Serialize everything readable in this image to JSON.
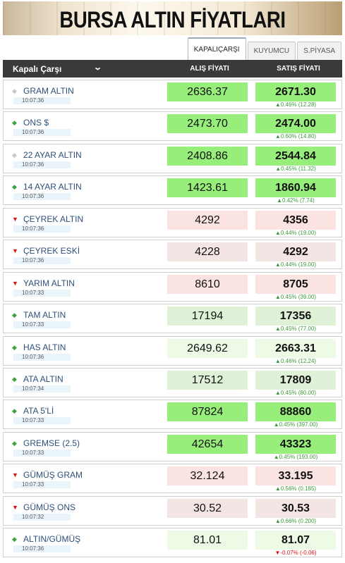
{
  "banner": {
    "title": "BURSA ALTIN FİYATLARI"
  },
  "tabs": [
    {
      "label": "KAPALIÇARŞI",
      "active": true
    },
    {
      "label": "KUYUMCU",
      "active": false
    },
    {
      "label": "S.PİYASA",
      "active": false
    }
  ],
  "header": {
    "market": "Kapalı Çarşı",
    "buy_label": "ALIŞ FİYATI",
    "sell_label": "SATIŞ FİYATI"
  },
  "colors": {
    "up": "#3aa33a",
    "down": "#dd1111",
    "strong_green": "#97ee7a",
    "light_green": "#dff2d8",
    "pink": "#fbe3e2"
  },
  "rows": [
    {
      "name": "GRAM ALTIN",
      "time": "10:07:36",
      "buy": "2636.37",
      "sell": "2671.30",
      "change": "▲0.46% (12.28)",
      "trend": "neutral",
      "bg": "green"
    },
    {
      "name": "ONS $",
      "time": "10:07:36",
      "buy": "2473.70",
      "sell": "2474.00",
      "change": "▲0.60% (14.80)",
      "trend": "up",
      "bg": "green"
    },
    {
      "name": "22 AYAR ALTIN",
      "time": "10:07:36",
      "buy": "2408.86",
      "sell": "2544.84",
      "change": "▲0.45% (11.32)",
      "trend": "neutral",
      "bg": "green"
    },
    {
      "name": "14 AYAR ALTIN",
      "time": "10:07:36",
      "buy": "1423.61",
      "sell": "1860.94",
      "change": "▲0.42% (7.74)",
      "trend": "up",
      "bg": "green"
    },
    {
      "name": "ÇEYREK ALTIN",
      "time": "10:07:36",
      "buy": "4292",
      "sell": "4356",
      "change": "▲0.44% (19.00)",
      "trend": "down",
      "bg": "pink"
    },
    {
      "name": "ÇEYREK ESKİ",
      "time": "10:07:36",
      "buy": "4228",
      "sell": "4292",
      "change": "▲0.44% (19.00)",
      "trend": "down",
      "bg": "lightpink"
    },
    {
      "name": "YARIM ALTIN",
      "time": "10:07:33",
      "buy": "8610",
      "sell": "8705",
      "change": "▲0.45% (39.00)",
      "trend": "down",
      "bg": "pink"
    },
    {
      "name": "TAM ALTIN",
      "time": "10:07:33",
      "buy": "17194",
      "sell": "17356",
      "change": "▲0.45% (77.00)",
      "trend": "up",
      "bg": "lightgreen"
    },
    {
      "name": "HAS ALTIN",
      "time": "10:07:36",
      "buy": "2649.62",
      "sell": "2663.31",
      "change": "▲0.46% (12.24)",
      "trend": "up",
      "bg": "verylight"
    },
    {
      "name": "ATA ALTIN",
      "time": "10:07:34",
      "buy": "17512",
      "sell": "17809",
      "change": "▲0.45% (80.00)",
      "trend": "up",
      "bg": "lightgreen"
    },
    {
      "name": "ATA 5'Lİ",
      "time": "10:07:33",
      "buy": "87824",
      "sell": "88860",
      "change": "▲0.45% (397.00)",
      "trend": "up",
      "bg": "green"
    },
    {
      "name": "GREMSE (2.5)",
      "time": "10:07:33",
      "buy": "42654",
      "sell": "43323",
      "change": "▲0.45% (193.00)",
      "trend": "up",
      "bg": "green"
    },
    {
      "name": "GÜMÜŞ GRAM",
      "time": "10:07:33",
      "buy": "32.124",
      "sell": "33.195",
      "change": "▲0.56% (0.185)",
      "trend": "down",
      "bg": "pink"
    },
    {
      "name": "GÜMÜŞ ONS",
      "time": "10:07:32",
      "buy": "30.52",
      "sell": "30.53",
      "change": "▲0.66% (0.200)",
      "trend": "down",
      "bg": "lightpink"
    },
    {
      "name": "ALTIN/GÜMÜŞ",
      "time": "10:07:36",
      "buy": "81.01",
      "sell": "81.07",
      "change": "▼-0.07% (-0.06)",
      "trend": "up",
      "bg": "verylight",
      "negative": true
    }
  ]
}
